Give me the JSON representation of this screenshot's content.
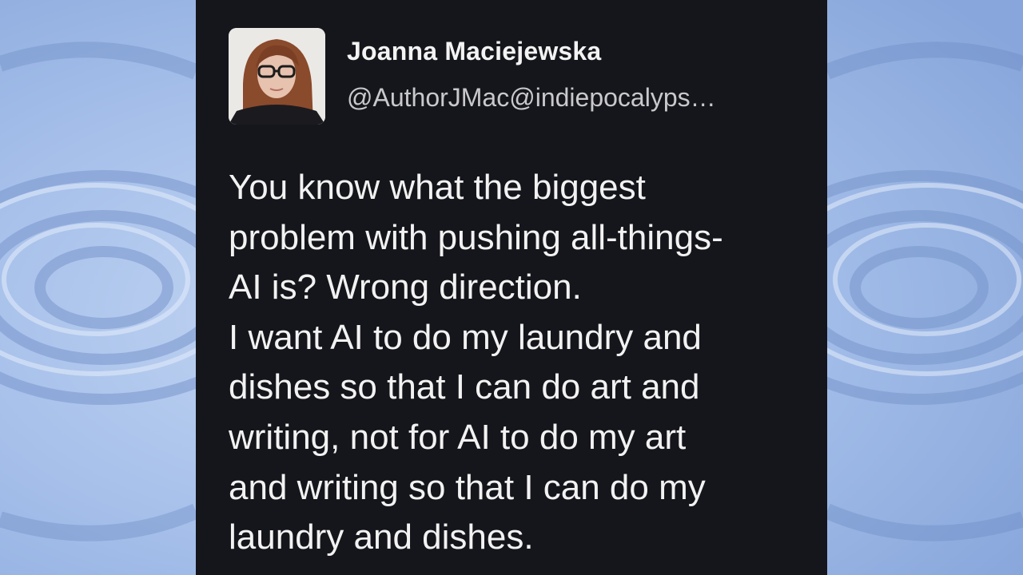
{
  "background": {
    "color": "#9db8e6",
    "accent": "#6f8fc8"
  },
  "post": {
    "author": {
      "name": "Joanna Maciejewska",
      "handle": "@AuthorJMac@indiepocalyps…"
    },
    "lines": [
      "You know what the biggest",
      "problem with pushing all-things-",
      "AI is? Wrong direction.",
      "I want AI to do my laundry and",
      "dishes so that I can do art and",
      "writing, not for AI to do my art",
      "and writing so that I can do my",
      "laundry and dishes."
    ],
    "colors": {
      "card": "#15161b",
      "text": "#f2f2f2",
      "handle": "#c9c9cc"
    }
  }
}
